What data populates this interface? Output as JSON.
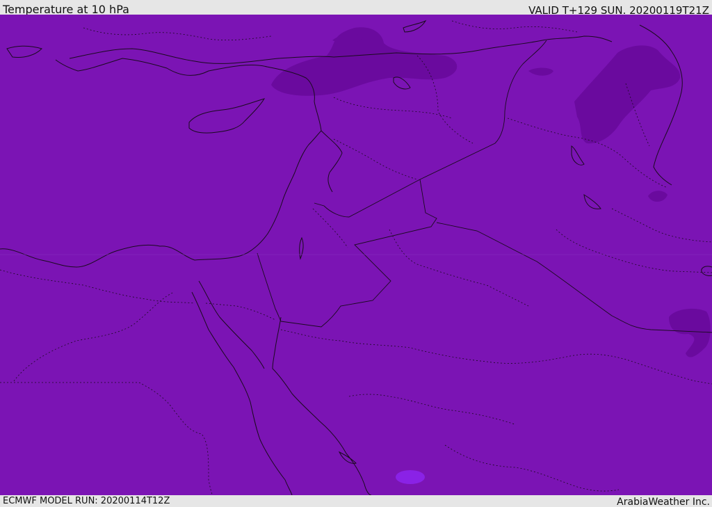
{
  "header": {
    "title": "Temperature at 10 hPa",
    "valid": "VALID T+129 SUN. 20200119T21Z"
  },
  "footer": {
    "model_run": "ECMWF MODEL RUN: 20200114T12Z",
    "credit": "ArabiaWeather Inc."
  },
  "map": {
    "fill_color": "#7b14b4",
    "cold_region_color": "#6a0a9e",
    "light_region_color": "#8a22e6",
    "line_color": "#1a0a1e"
  }
}
